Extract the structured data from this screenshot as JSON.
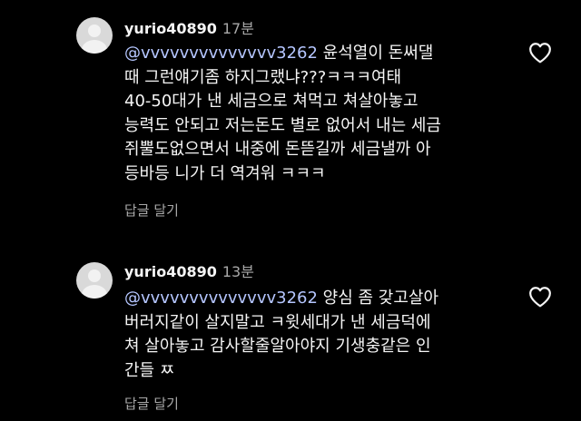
{
  "comments": [
    {
      "username": "yurio40890",
      "time": "17분",
      "mention": "@vvvvvvvvvvvvvv3262",
      "lines": [
        " 윤석열이 돈써댈",
        "때 그런얘기좀 하지그랬냐???ㅋㅋㅋ여태",
        "40-50대가 낸 세금으로 쳐먹고 쳐살아놓고",
        "능력도 안되고 저는돈도 별로 없어서 내는 세금",
        "쥐뿔도없으면서 내중에 돈뜯길까 세금낼까 아",
        "등바등 니가 더 역겨워 ㅋㅋㅋ"
      ],
      "reply_label": "답글 달기",
      "like_icon": "heart-outline-icon"
    },
    {
      "username": "yurio40890",
      "time": "13분",
      "mention": "@vvvvvvvvvvvvvv3262",
      "lines": [
        " 양심 좀 갖고살아",
        "버러지같이 살지말고 ㅋ윗세대가 낸 세금덕에",
        "쳐 살아놓고 감사할줄알아야지 기생충같은 인",
        "간들 ㅉ"
      ],
      "reply_label": "답글 달기",
      "like_icon": "heart-outline-icon"
    }
  ],
  "colors": {
    "background": "#000000",
    "text": "#f5f5f5",
    "secondary": "#a8a8a8",
    "mention": "#b5c6ff",
    "avatar": "#d9d9d9"
  }
}
